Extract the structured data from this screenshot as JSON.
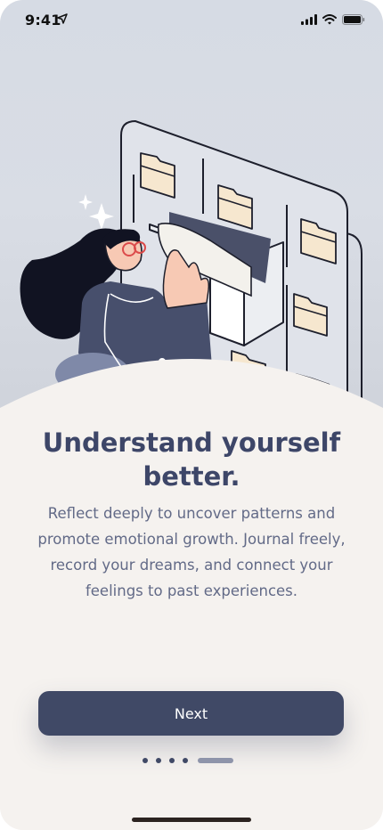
{
  "status_bar": {
    "time": "9:41"
  },
  "onboarding": {
    "title": "Understand yourself better.",
    "body": "Reflect deeply to uncover patterns and promote emotional growth. Journal freely, record your dreams, and connect your feelings to past experiences.",
    "next_label": "Next",
    "page_total": 5,
    "page_current": 5
  },
  "colors": {
    "primary": "#404966",
    "title": "#3d4668",
    "body_text": "#626a87",
    "background": "#f5f2ef",
    "hero_background": "#d8dce4"
  },
  "icons": {
    "status_location": "location-arrow-icon",
    "status_signal": "cellular-signal-icon",
    "status_wifi": "wifi-icon",
    "status_battery": "battery-icon"
  }
}
